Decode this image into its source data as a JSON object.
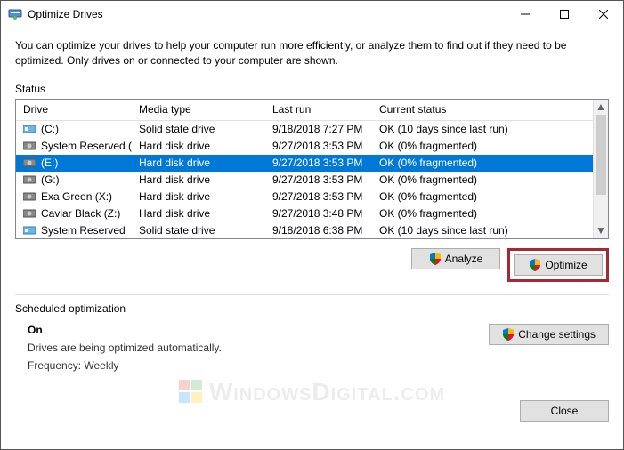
{
  "window": {
    "title": "Optimize Drives",
    "description": "You can optimize your drives to help your computer run more efficiently, or analyze them to find out if they need to be optimized. Only drives on or connected to your computer are shown."
  },
  "status_label": "Status",
  "columns": {
    "drive": "Drive",
    "media": "Media type",
    "last": "Last run",
    "status": "Current status"
  },
  "rows": [
    {
      "name": "(C:)",
      "icon": "ssd",
      "media": "Solid state drive",
      "last": "9/18/2018 7:27 PM",
      "status": "OK (10 days since last run)",
      "selected": false
    },
    {
      "name": "System Reserved (D:)",
      "icon": "hdd",
      "media": "Hard disk drive",
      "last": "9/27/2018 3:53 PM",
      "status": "OK (0% fragmented)",
      "selected": false
    },
    {
      "name": "(E:)",
      "icon": "hdd",
      "media": "Hard disk drive",
      "last": "9/27/2018 3:53 PM",
      "status": "OK (0% fragmented)",
      "selected": true
    },
    {
      "name": "(G:)",
      "icon": "hdd",
      "media": "Hard disk drive",
      "last": "9/27/2018 3:53 PM",
      "status": "OK (0% fragmented)",
      "selected": false
    },
    {
      "name": "Exa Green (X:)",
      "icon": "hdd",
      "media": "Hard disk drive",
      "last": "9/27/2018 3:53 PM",
      "status": "OK (0% fragmented)",
      "selected": false
    },
    {
      "name": "Caviar Black (Z:)",
      "icon": "hdd",
      "media": "Hard disk drive",
      "last": "9/27/2018 3:48 PM",
      "status": "OK (0% fragmented)",
      "selected": false
    },
    {
      "name": "System Reserved",
      "icon": "ssd",
      "media": "Solid state drive",
      "last": "9/18/2018 6:38 PM",
      "status": "OK (10 days since last run)",
      "selected": false
    }
  ],
  "buttons": {
    "analyze": "Analyze",
    "optimize": "Optimize",
    "change": "Change settings",
    "close": "Close"
  },
  "scheduled": {
    "label": "Scheduled optimization",
    "state": "On",
    "desc": "Drives are being optimized automatically.",
    "freq": "Frequency: Weekly"
  },
  "watermark": "WindowsDigital.com"
}
